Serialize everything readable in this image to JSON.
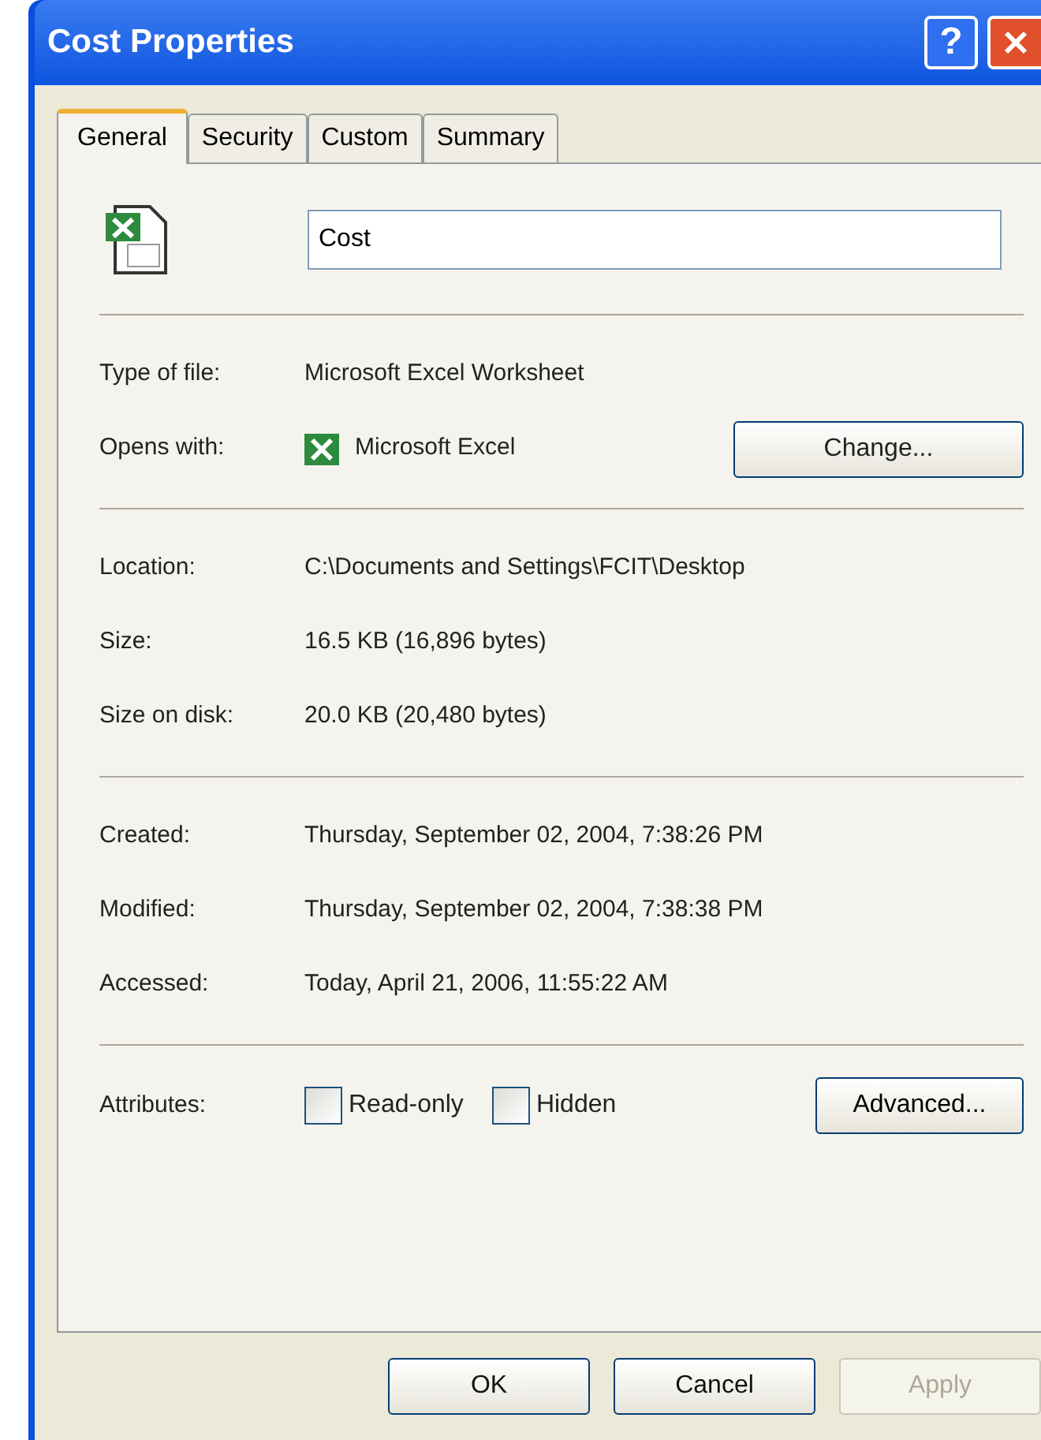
{
  "window": {
    "title": "Cost Properties",
    "help_glyph": "?"
  },
  "tabs": [
    {
      "label": "General",
      "selected": true
    },
    {
      "label": "Security",
      "selected": false
    },
    {
      "label": "Custom",
      "selected": false
    },
    {
      "label": "Summary",
      "selected": false
    }
  ],
  "file_name": {
    "value": "Cost"
  },
  "sections": [
    [
      {
        "kind": "text",
        "label": "Type of file:",
        "value": "Microsoft Excel Worksheet"
      },
      {
        "kind": "app",
        "label": "Opens with:",
        "value": "Microsoft Excel",
        "button": "Change..."
      }
    ],
    [
      {
        "kind": "text",
        "label": "Location:",
        "value": "C:\\Documents and Settings\\FCIT\\Desktop"
      },
      {
        "kind": "text",
        "label": "Size:",
        "value": "16.5 KB (16,896 bytes)"
      },
      {
        "kind": "text",
        "label": "Size on disk:",
        "value": "20.0 KB (20,480 bytes)"
      }
    ],
    [
      {
        "kind": "text",
        "label": "Created:",
        "value": "Thursday, September 02, 2004, 7:38:26 PM"
      },
      {
        "kind": "text",
        "label": "Modified:",
        "value": "Thursday, September 02, 2004, 7:38:38 PM"
      },
      {
        "kind": "text",
        "label": "Accessed:",
        "value": "Today, April 21, 2006, 11:55:22 AM"
      }
    ]
  ],
  "attributes": {
    "label": "Attributes:",
    "options": [
      {
        "label": "Read-only",
        "checked": false
      },
      {
        "label": "Hidden",
        "checked": false
      }
    ],
    "button": "Advanced..."
  },
  "buttons": [
    {
      "label": "OK",
      "disabled": false
    },
    {
      "label": "Cancel",
      "disabled": false
    },
    {
      "label": "Apply",
      "disabled": true
    }
  ]
}
